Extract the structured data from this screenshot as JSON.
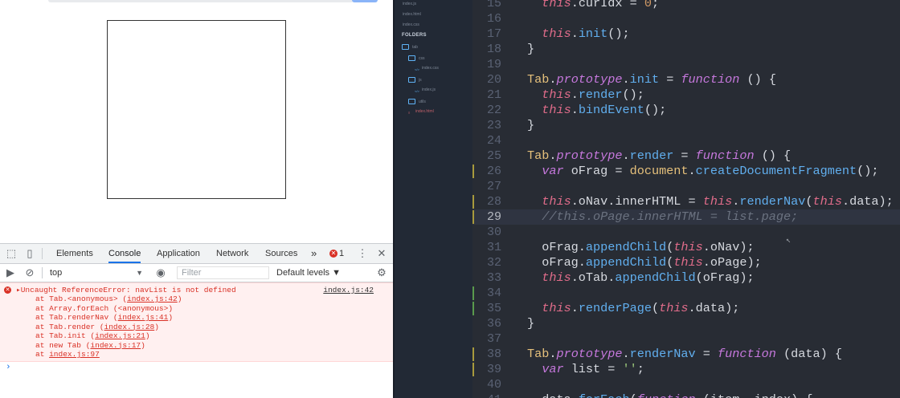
{
  "devtools": {
    "tabs": [
      "Elements",
      "Console",
      "Application",
      "Network",
      "Sources"
    ],
    "more_tabs": "»",
    "error_count": "1",
    "context": "top",
    "filter_placeholder": "Filter",
    "levels": "Default levels ▼"
  },
  "console": {
    "error_message": "Uncaught ReferenceError: navList is not defined",
    "error_source": "index.js:42",
    "stack": [
      {
        "prefix": "at Tab.<anonymous> (",
        "link": "index.js:42",
        "suffix": ")"
      },
      {
        "prefix": "at Array.forEach (<anonymous>)",
        "link": "",
        "suffix": ""
      },
      {
        "prefix": "at Tab.renderNav (",
        "link": "index.js:41",
        "suffix": ")"
      },
      {
        "prefix": "at Tab.render (",
        "link": "index.js:28",
        "suffix": ")"
      },
      {
        "prefix": "at Tab.init (",
        "link": "index.js:21",
        "suffix": ")"
      },
      {
        "prefix": "at new Tab (",
        "link": "index.js:17",
        "suffix": ")"
      },
      {
        "prefix": "at ",
        "link": "index.js:97",
        "suffix": ""
      }
    ],
    "prompt": "›"
  },
  "sidebar": {
    "open_files": [
      "index.js",
      "index.html",
      "index.css"
    ],
    "folders_label": "FOLDERS",
    "tree": [
      {
        "label": "tab",
        "type": "folder",
        "depth": 0
      },
      {
        "label": "css",
        "type": "folder",
        "depth": 1
      },
      {
        "label": "index.css",
        "type": "file",
        "depth": 2
      },
      {
        "label": "js",
        "type": "folder",
        "depth": 1
      },
      {
        "label": "index.js",
        "type": "file",
        "depth": 2
      },
      {
        "label": "utils",
        "type": "folder",
        "depth": 1
      },
      {
        "label": "index.html",
        "type": "file-red",
        "depth": 1
      }
    ]
  },
  "editor": {
    "current_line": 29,
    "lines": [
      {
        "n": 15,
        "mark": "",
        "tokens": [
          [
            "t",
            "  this"
          ],
          [
            "p",
            "."
          ],
          [
            "p",
            "curIdx"
          ],
          [
            "p",
            " = "
          ],
          [
            "n",
            "0"
          ],
          [
            "p",
            ";"
          ]
        ]
      },
      {
        "n": 16,
        "mark": "",
        "tokens": []
      },
      {
        "n": 17,
        "mark": "",
        "tokens": [
          [
            "t",
            "  this"
          ],
          [
            "p",
            "."
          ],
          [
            "f",
            "init"
          ],
          [
            "p",
            "();"
          ]
        ]
      },
      {
        "n": 18,
        "mark": "",
        "tokens": [
          [
            "p",
            "}"
          ]
        ]
      },
      {
        "n": 19,
        "mark": "",
        "tokens": []
      },
      {
        "n": 20,
        "mark": "",
        "tokens": [
          [
            "c",
            "Tab"
          ],
          [
            "p",
            "."
          ],
          [
            "k",
            "prototype"
          ],
          [
            "p",
            "."
          ],
          [
            "f",
            "init"
          ],
          [
            "p",
            " = "
          ],
          [
            "k",
            "function"
          ],
          [
            "p",
            " () {"
          ]
        ]
      },
      {
        "n": 21,
        "mark": "",
        "tokens": [
          [
            "t",
            "  this"
          ],
          [
            "p",
            "."
          ],
          [
            "f",
            "render"
          ],
          [
            "p",
            "();"
          ]
        ]
      },
      {
        "n": 22,
        "mark": "",
        "tokens": [
          [
            "t",
            "  this"
          ],
          [
            "p",
            "."
          ],
          [
            "f",
            "bindEvent"
          ],
          [
            "p",
            "();"
          ]
        ]
      },
      {
        "n": 23,
        "mark": "",
        "tokens": [
          [
            "p",
            "}"
          ]
        ]
      },
      {
        "n": 24,
        "mark": "",
        "tokens": []
      },
      {
        "n": 25,
        "mark": "",
        "tokens": [
          [
            "c",
            "Tab"
          ],
          [
            "p",
            "."
          ],
          [
            "k",
            "prototype"
          ],
          [
            "p",
            "."
          ],
          [
            "f",
            "render"
          ],
          [
            "p",
            " = "
          ],
          [
            "k",
            "function"
          ],
          [
            "p",
            " () {"
          ]
        ]
      },
      {
        "n": 26,
        "mark": "yellow",
        "tokens": [
          [
            "k",
            "  var"
          ],
          [
            "p",
            " oFrag = "
          ],
          [
            "c",
            "document"
          ],
          [
            "p",
            "."
          ],
          [
            "f",
            "createDocumentFragment"
          ],
          [
            "p",
            "();"
          ]
        ]
      },
      {
        "n": 27,
        "mark": "",
        "tokens": []
      },
      {
        "n": 28,
        "mark": "yellow",
        "tokens": [
          [
            "t",
            "  this"
          ],
          [
            "p",
            ".oNav."
          ],
          [
            "p",
            "innerHTML"
          ],
          [
            "p",
            " = "
          ],
          [
            "t",
            "this"
          ],
          [
            "p",
            "."
          ],
          [
            "f",
            "renderNav"
          ],
          [
            "p",
            "("
          ],
          [
            "t",
            "this"
          ],
          [
            "p",
            ".data);"
          ]
        ]
      },
      {
        "n": 29,
        "mark": "yellow",
        "tokens": [
          [
            "m",
            "  //this.oPage.innerHTML = list.page;"
          ]
        ]
      },
      {
        "n": 30,
        "mark": "",
        "tokens": []
      },
      {
        "n": 31,
        "mark": "",
        "tokens": [
          [
            "p",
            "  oFrag."
          ],
          [
            "f",
            "appendChild"
          ],
          [
            "p",
            "("
          ],
          [
            "t",
            "this"
          ],
          [
            "p",
            ".oNav);"
          ]
        ]
      },
      {
        "n": 32,
        "mark": "",
        "tokens": [
          [
            "p",
            "  oFrag."
          ],
          [
            "f",
            "appendChild"
          ],
          [
            "p",
            "("
          ],
          [
            "t",
            "this"
          ],
          [
            "p",
            ".oPage);"
          ]
        ]
      },
      {
        "n": 33,
        "mark": "",
        "tokens": [
          [
            "t",
            "  this"
          ],
          [
            "p",
            ".oTab."
          ],
          [
            "f",
            "appendChild"
          ],
          [
            "p",
            "(oFrag);"
          ]
        ]
      },
      {
        "n": 34,
        "mark": "green",
        "tokens": []
      },
      {
        "n": 35,
        "mark": "green",
        "tokens": [
          [
            "t",
            "  this"
          ],
          [
            "p",
            "."
          ],
          [
            "f",
            "renderPage"
          ],
          [
            "p",
            "("
          ],
          [
            "t",
            "this"
          ],
          [
            "p",
            ".data);"
          ]
        ]
      },
      {
        "n": 36,
        "mark": "",
        "tokens": [
          [
            "p",
            "}"
          ]
        ]
      },
      {
        "n": 37,
        "mark": "",
        "tokens": []
      },
      {
        "n": 38,
        "mark": "yellow",
        "tokens": [
          [
            "c",
            "Tab"
          ],
          [
            "p",
            "."
          ],
          [
            "k",
            "prototype"
          ],
          [
            "p",
            "."
          ],
          [
            "f",
            "renderNav"
          ],
          [
            "p",
            " = "
          ],
          [
            "k",
            "function"
          ],
          [
            "p",
            " (data) {"
          ]
        ]
      },
      {
        "n": 39,
        "mark": "yellow",
        "tokens": [
          [
            "k",
            "  var"
          ],
          [
            "p",
            " list = "
          ],
          [
            "s",
            "''"
          ],
          [
            "p",
            ";"
          ]
        ]
      },
      {
        "n": 40,
        "mark": "",
        "tokens": []
      },
      {
        "n": 41,
        "mark": "",
        "tokens": [
          [
            "p",
            "  data."
          ],
          [
            "f",
            "forEach"
          ],
          [
            "p",
            "("
          ],
          [
            "k",
            "function"
          ],
          [
            "p",
            " (item, index) {"
          ]
        ]
      }
    ]
  }
}
